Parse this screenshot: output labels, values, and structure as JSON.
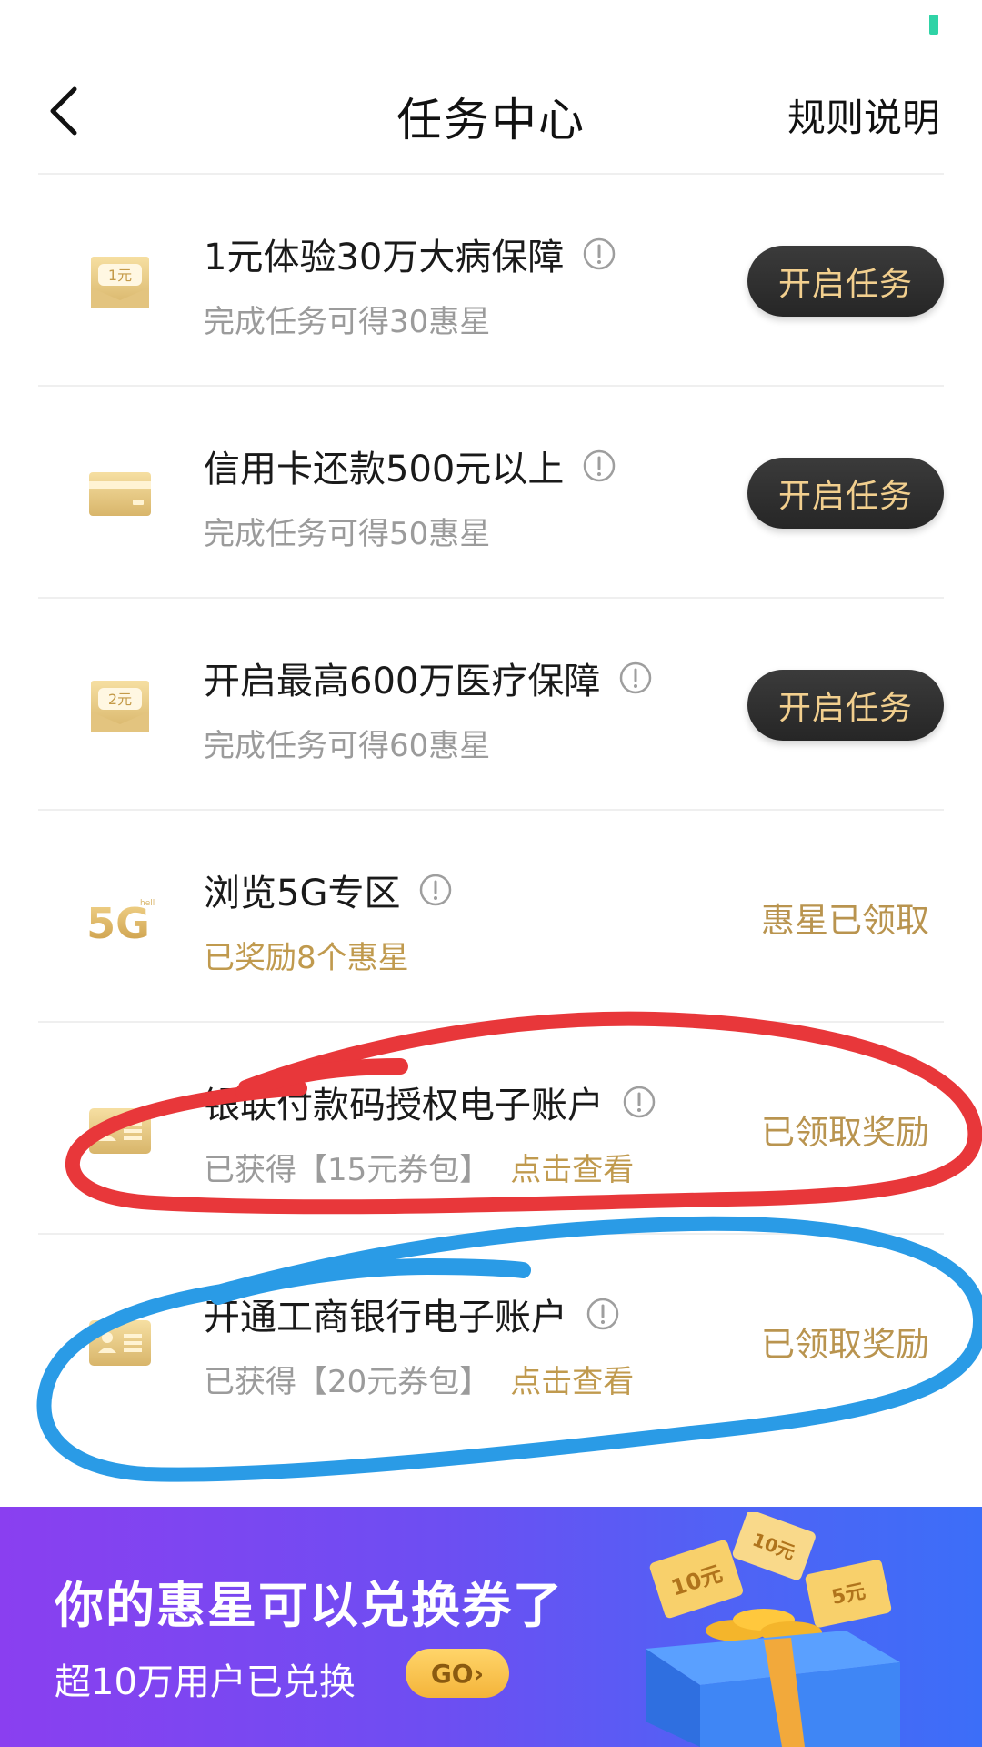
{
  "nav": {
    "title": "任务中心",
    "rules_label": "规则说明"
  },
  "tasks": [
    {
      "title": "1元体验30万大病保障",
      "subtitle": "完成任务可得30惠星",
      "action": "开启任务",
      "icon": "ticket-1yuan-icon",
      "icon_text": "1元"
    },
    {
      "title": "信用卡还款500元以上",
      "subtitle": "完成任务可得50惠星",
      "action": "开启任务",
      "icon": "credit-card-icon"
    },
    {
      "title": "开启最高600万医疗保障",
      "subtitle": "完成任务可得60惠星",
      "action": "开启任务",
      "icon": "ticket-2yuan-icon",
      "icon_text": "2元"
    },
    {
      "title": "浏览5G专区",
      "subtitle": "已奖励8个惠星",
      "status": "惠星已领取",
      "icon": "5g-icon",
      "icon_text": "5G",
      "icon_subtext": "hello"
    },
    {
      "title": "银联付款码授权电子账户",
      "subtitle": "已获得【15元券包】",
      "link": "点击查看",
      "status": "已领取奖励",
      "icon": "id-card-icon"
    },
    {
      "title": "开通工商银行电子账户",
      "subtitle": "已获得【20元券包】",
      "link": "点击查看",
      "status": "已领取奖励",
      "icon": "id-card-icon"
    }
  ],
  "banner": {
    "title": "你的惠星可以兑换券了",
    "subtitle": "超10万用户已兑换",
    "go_label": "GO›",
    "coupon_labels": [
      "10元",
      "10元",
      "5元"
    ]
  },
  "colors": {
    "gold": "#c09a4e",
    "dark_button": "#2e2e2e",
    "red_annotation": "#e8373a",
    "blue_annotation": "#2a9be6"
  }
}
